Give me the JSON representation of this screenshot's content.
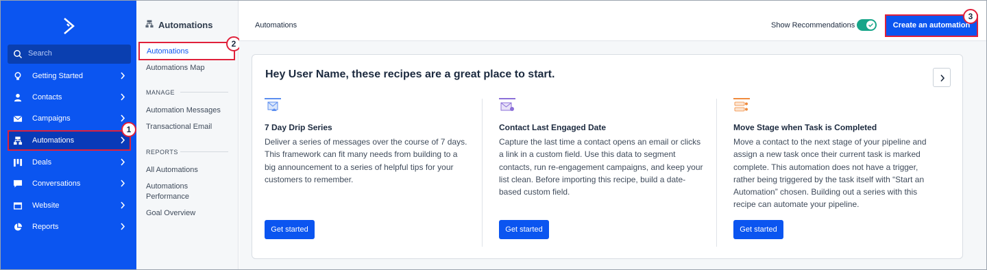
{
  "sidebar": {
    "search_placeholder": "Search",
    "items": [
      {
        "label": "Getting Started",
        "icon": "lightbulb-icon"
      },
      {
        "label": "Contacts",
        "icon": "person-icon"
      },
      {
        "label": "Campaigns",
        "icon": "envelope-icon"
      },
      {
        "label": "Automations",
        "icon": "automation-icon",
        "active": true
      },
      {
        "label": "Deals",
        "icon": "pipeline-icon"
      },
      {
        "label": "Conversations",
        "icon": "chat-icon"
      },
      {
        "label": "Website",
        "icon": "browser-icon"
      },
      {
        "label": "Reports",
        "icon": "pie-chart-icon"
      }
    ]
  },
  "subnav": {
    "title": "Automations",
    "items": [
      "Automations",
      "Automations Map"
    ],
    "manage_label": "MANAGE",
    "manage_items": [
      "Automation Messages",
      "Transactional Email"
    ],
    "reports_label": "REPORTS",
    "reports_items": [
      "All Automations",
      "Automations Performance",
      "Goal Overview"
    ]
  },
  "topbar": {
    "title": "Automations",
    "recommendations_label": "Show Recommendations",
    "recommendations_on": true,
    "create_label": "Create an automation"
  },
  "card": {
    "heading": "Hey User Name, these recipes are a great place to start.",
    "recipes": [
      {
        "title": "7 Day Drip Series",
        "description": "Deliver a series of messages over the course of 7 days. This framework can fit many needs from building to a big announcement to a series of helpful tips for your customers to remember.",
        "button": "Get started"
      },
      {
        "title": "Contact Last Engaged Date",
        "description": "Capture the last time a contact opens an email or clicks a link in a custom field. Use this data to segment contacts, run re-engagement campaigns, and keep your list clean. Before importing this recipe, build a date-based custom field.",
        "button": "Get started"
      },
      {
        "title": "Move Stage when Task is Completed",
        "description": "Move a contact to the next stage of your pipeline and assign a new task once their current task is marked complete. This automation does not have a trigger, rather being triggered by the task itself with “Start an Automation” chosen. Building out a series with this recipe can automate your pipeline.",
        "button": "Get started"
      }
    ]
  },
  "callouts": [
    "1",
    "2",
    "3"
  ],
  "colors": {
    "brand_blue": "#0b55f0",
    "highlight_red": "#e0203a",
    "toggle_green": "#17a589"
  }
}
